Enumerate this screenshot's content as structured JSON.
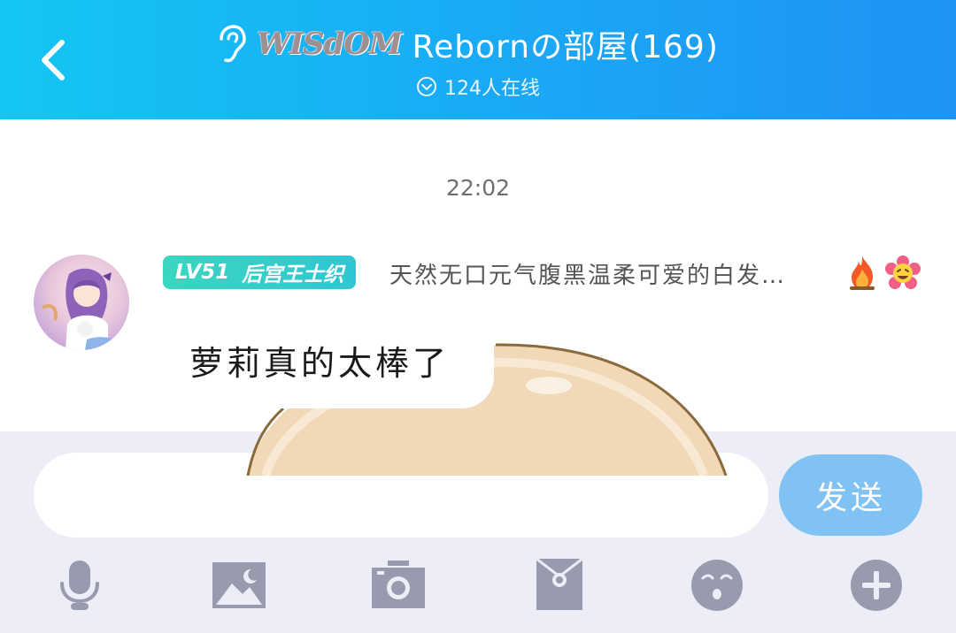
{
  "header": {
    "brand_logo": "WISdOM",
    "room_title": "Rebornの部屋(169)",
    "online_count": "124人在线",
    "colors": {
      "gradient_start": "#13c6f4",
      "gradient_end": "#1e93f3"
    }
  },
  "chat": {
    "timestamp": "22:02",
    "message": {
      "level": "LV51",
      "title_badge": "后宫王士织",
      "username": "天然无口元气腹黑温柔可爱的白发…",
      "text": "萝莉真的太棒了",
      "username_icons": [
        "fire-icon",
        "flower-smile-icon"
      ]
    }
  },
  "input": {
    "placeholder": "",
    "value": "",
    "send_label": "发送",
    "colors": {
      "send_button": "#7fc2f3",
      "panel": "#ecedf6",
      "icon": "#9a9aaf"
    }
  },
  "toolbar": {
    "icons": [
      "microphone-icon",
      "image-icon",
      "camera-icon",
      "red-packet-icon",
      "emoji-icon",
      "plus-icon"
    ]
  }
}
